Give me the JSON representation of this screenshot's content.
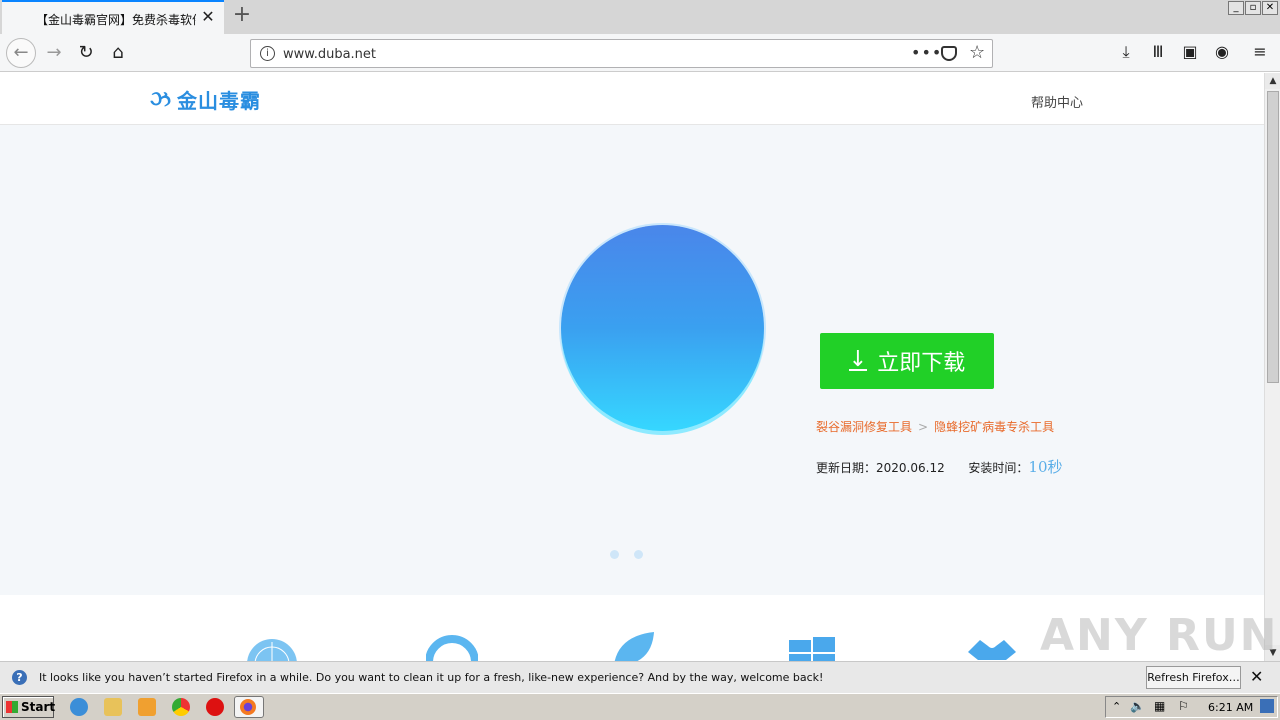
{
  "browser": {
    "tab_title": "【金山毒霸官网】免费杀毒软件|E",
    "url": "www.duba.net",
    "new_tab_label": "+",
    "page_actions_label": "•••"
  },
  "page": {
    "logo_text": "金山毒霸",
    "help_link": "帮助中心",
    "download_button": "立即下载",
    "links": [
      "裂谷漏洞修复工具",
      "隐蜂挖矿病毒专杀工具"
    ],
    "link_separator": ">",
    "update_label": "更新日期：",
    "update_date": "2020.06.12",
    "install_label": "安装时间：",
    "install_time": "10秒",
    "slide_count": 2
  },
  "notification": {
    "message": "It looks like you haven’t started Firefox in a while. Do you want to clean it up for a fresh, like-new experience? And by the way, welcome back!",
    "button": "Refresh Firefox…"
  },
  "taskbar": {
    "start_label": "Start",
    "clock": "6:21 AM"
  },
  "watermark": "ANY RUN",
  "colors": {
    "accent": "#0a84ff",
    "download_green": "#21d027",
    "link_orange": "#e86a2a",
    "logo_blue": "#2a8ee0"
  }
}
